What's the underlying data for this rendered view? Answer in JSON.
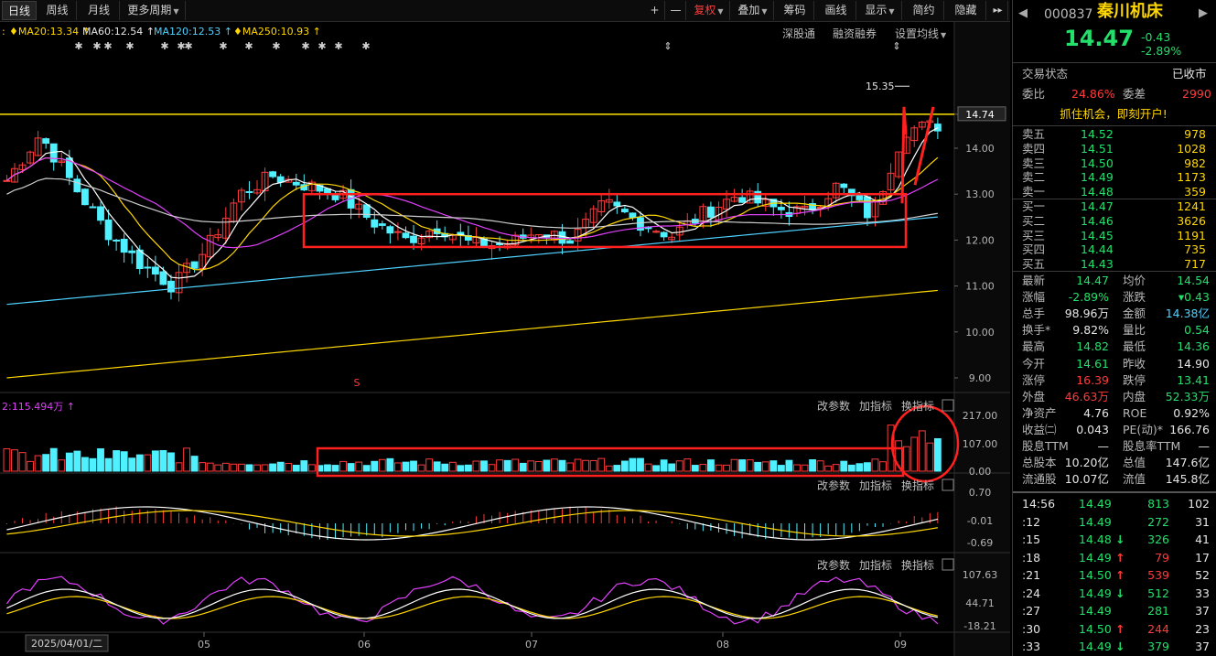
{
  "toolbar": {
    "tabs": [
      "日线",
      "周线",
      "月线"
    ],
    "more": "更多周期",
    "plus": "+",
    "minus": "—",
    "fuquan": "复权",
    "diejia": "叠加",
    "chouma": "筹码",
    "huaxian": "画线",
    "xianshi": "显示",
    "jianyue": "简约",
    "yincang": "隐藏",
    "expand": "▸▸"
  },
  "ma_legend": [
    {
      "label": "MA20:13.34",
      "color": "#ffd700"
    },
    {
      "label": "MA60:12.54",
      "color": "#e6e6e6"
    },
    {
      "label": "MA120:12.53",
      "color": "#4fd2ff"
    },
    {
      "label": "MA250:10.93",
      "color": "#ffd700"
    }
  ],
  "top_links": [
    "深股通",
    "融资融券",
    "设置均线"
  ],
  "price_axis": [
    "14.74",
    "14.00",
    "13.00",
    "12.00",
    "11.00",
    "10.00",
    "9.00"
  ],
  "marker_high": "15.35",
  "marker_s": "S",
  "volume": {
    "label": "2:115.494万",
    "axis": [
      "217.00",
      "107.00",
      "0.00"
    ]
  },
  "macd": {
    "axis": [
      "0.70",
      "-0.01",
      "-0.69"
    ]
  },
  "kdj": {
    "axis": [
      "107.63",
      "44.71",
      "-18.21"
    ]
  },
  "panel_links": [
    "改参数",
    "加指标",
    "换指标"
  ],
  "x_axis": {
    "date": "2025/04/01/二",
    "months": [
      "05",
      "06",
      "07",
      "08",
      "09"
    ]
  },
  "quote": {
    "code": "000837",
    "name": "秦川机床",
    "price": "14.47",
    "change": "-0.43",
    "pct": "-2.89%",
    "status_label": "交易状态",
    "status": "已收市",
    "weibi_label": "委比",
    "weibi": "24.86%",
    "weicha_label": "委差",
    "weicha": "2990",
    "promo": "抓住机会，即刻开户!",
    "asks": [
      {
        "label": "卖五",
        "price": "14.52",
        "vol": "978"
      },
      {
        "label": "卖四",
        "price": "14.51",
        "vol": "1028"
      },
      {
        "label": "卖三",
        "price": "14.50",
        "vol": "982"
      },
      {
        "label": "卖二",
        "price": "14.49",
        "vol": "1173"
      },
      {
        "label": "卖一",
        "price": "14.48",
        "vol": "359"
      }
    ],
    "bids": [
      {
        "label": "买一",
        "price": "14.47",
        "vol": "1241"
      },
      {
        "label": "买二",
        "price": "14.46",
        "vol": "3626"
      },
      {
        "label": "买三",
        "price": "14.45",
        "vol": "1191"
      },
      {
        "label": "买四",
        "price": "14.44",
        "vol": "735"
      },
      {
        "label": "买五",
        "price": "14.43",
        "vol": "717"
      }
    ],
    "stats": [
      {
        "l1": "最新",
        "v1": "14.47",
        "c1": "g",
        "l2": "均价",
        "v2": "14.54",
        "c2": "g"
      },
      {
        "l1": "涨幅",
        "v1": "-2.89%",
        "c1": "g",
        "l2": "涨跌",
        "v2": "▾0.43",
        "c2": "g"
      },
      {
        "l1": "总手",
        "v1": "98.96万",
        "c1": "w",
        "l2": "金额",
        "v2": "14.38亿",
        "c2": "c"
      },
      {
        "l1": "换手*",
        "v1": "9.82%",
        "c1": "w",
        "l2": "量比",
        "v2": "0.54",
        "c2": "g"
      },
      {
        "l1": "最高",
        "v1": "14.82",
        "c1": "g",
        "l2": "最低",
        "v2": "14.36",
        "c2": "g"
      },
      {
        "l1": "今开",
        "v1": "14.61",
        "c1": "g",
        "l2": "昨收",
        "v2": "14.90",
        "c2": "w"
      },
      {
        "l1": "涨停",
        "v1": "16.39",
        "c1": "r",
        "l2": "跌停",
        "v2": "13.41",
        "c2": "g"
      },
      {
        "l1": "外盘",
        "v1": "46.63万",
        "c1": "r",
        "l2": "内盘",
        "v2": "52.33万",
        "c2": "g"
      },
      {
        "l1": "净资产",
        "v1": "4.76",
        "c1": "w",
        "l2": "ROE",
        "v2": "0.92%",
        "c2": "w"
      },
      {
        "l1": "收益㈡",
        "v1": "0.043",
        "c1": "w",
        "l2": "PE(动)*",
        "v2": "166.76",
        "c2": "w"
      },
      {
        "l1": "股息TTM",
        "v1": "—",
        "c1": "w",
        "l2": "股息率TTM",
        "v2": "—",
        "c2": "w"
      },
      {
        "l1": "总股本",
        "v1": "10.20亿",
        "c1": "w",
        "l2": "总值",
        "v2": "147.6亿",
        "c2": "w"
      },
      {
        "l1": "流通股",
        "v1": "10.07亿",
        "c1": "w",
        "l2": "流值",
        "v2": "145.8亿",
        "c2": "w"
      }
    ],
    "ticks": [
      {
        "t": "14:56",
        "p": "14.49",
        "a": "",
        "v": "813",
        "n": "102"
      },
      {
        "t": ":12",
        "p": "14.49",
        "a": "",
        "v": "272",
        "n": "31"
      },
      {
        "t": ":15",
        "p": "14.48",
        "a": "↓",
        "v": "326",
        "n": "41"
      },
      {
        "t": ":18",
        "p": "14.49",
        "a": "↑",
        "v": "79",
        "n": "17"
      },
      {
        "t": ":21",
        "p": "14.50",
        "a": "↑",
        "v": "539",
        "n": "52"
      },
      {
        "t": ":24",
        "p": "14.49",
        "a": "↓",
        "v": "512",
        "n": "33"
      },
      {
        "t": ":27",
        "p": "14.49",
        "a": "",
        "v": "281",
        "n": "37"
      },
      {
        "t": ":30",
        "p": "14.50",
        "a": "↑",
        "v": "244",
        "n": "23"
      },
      {
        "t": ":33",
        "p": "14.49",
        "a": "↓",
        "v": "379",
        "n": "37"
      }
    ]
  }
}
